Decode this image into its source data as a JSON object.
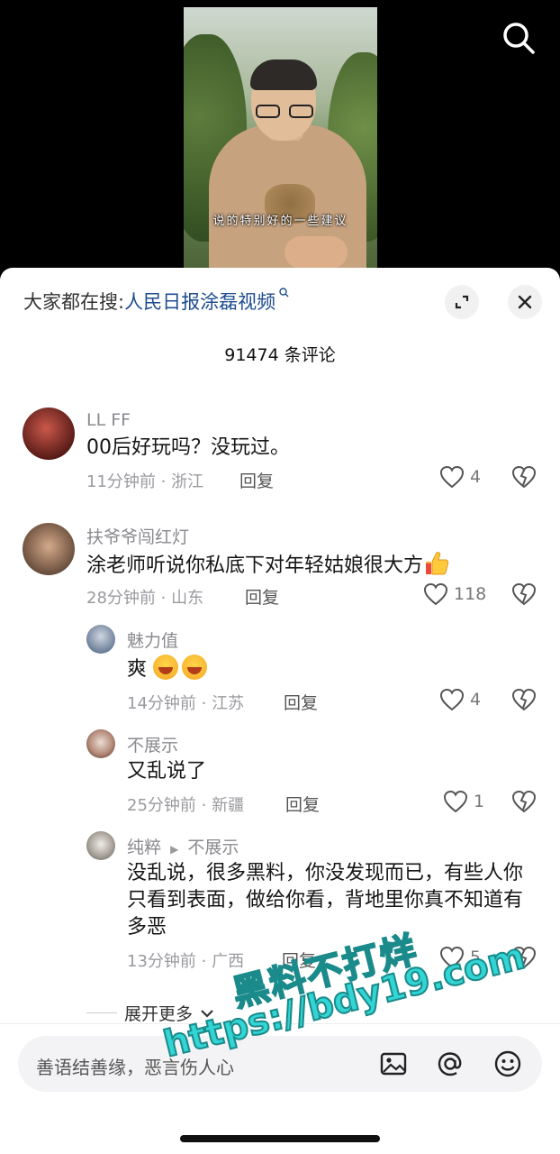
{
  "video": {
    "subtitle": "说的特别好的一些建议"
  },
  "sheet": {
    "hot_search_prefix": "大家都在搜:",
    "hot_search_keyword": "人民日报涂磊视频",
    "comment_count": "91474 条评论"
  },
  "comments": [
    {
      "name": "LL FF",
      "text": "00后好玩吗？没玩过。",
      "meta": "11分钟前 · 浙江",
      "reply": "回复",
      "likes": "4"
    },
    {
      "name": "扶爷爷闯红灯",
      "text": "涂老师听说你私底下对年轻姑娘很大方",
      "meta": "28分钟前 · 山东",
      "reply": "回复",
      "likes": "118"
    }
  ],
  "replies": [
    {
      "name": "魅力值",
      "text": "爽",
      "meta": "14分钟前 · 江苏",
      "reply": "回复",
      "likes": "4"
    },
    {
      "name": "不展示",
      "text": "又乱说了",
      "meta": "25分钟前 · 新疆",
      "reply": "回复",
      "likes": "1"
    },
    {
      "name": "纯粹",
      "reply_to": "不展示",
      "text": "没乱说，很多黑料，你没发现而已，有些人你只看到表面，做给你看，背地里你真不知道有多恶",
      "meta": "13分钟前 · 广西",
      "reply": "回复",
      "likes": "5"
    }
  ],
  "expand_more": "展开更多",
  "input": {
    "placeholder": "善语结善缘，恶言伤人心"
  },
  "watermark": {
    "line1": "黑料不打烊",
    "line2": "https://bdy19.com"
  },
  "colors": {
    "link": "#1e4d8f",
    "watermark": "#33d4d4",
    "sheet_bg": "#ffffff"
  }
}
